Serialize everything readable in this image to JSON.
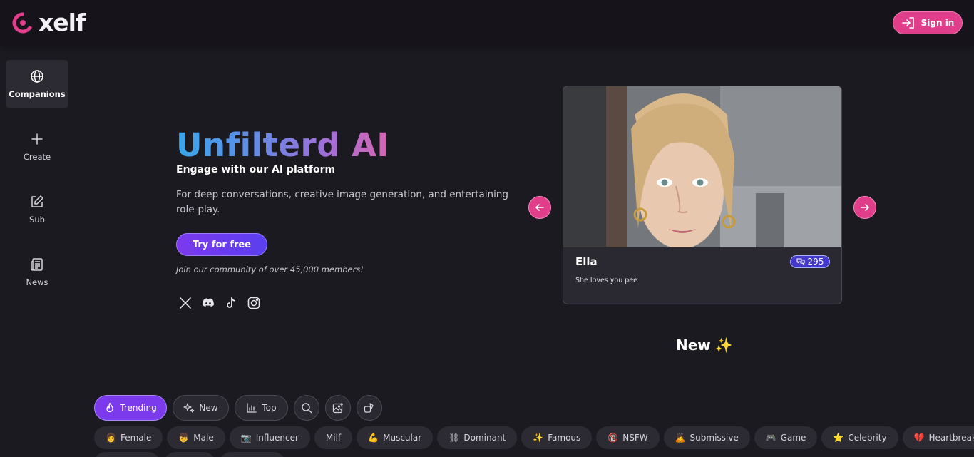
{
  "header": {
    "logo_text": "xelf",
    "signin_label": "Sign in",
    "accent_color": "#e03e8a"
  },
  "sidebar": {
    "items": [
      {
        "label": "Companions",
        "icon": "globe-icon",
        "active": true
      },
      {
        "label": "Create",
        "icon": "plus-icon",
        "active": false
      },
      {
        "label": "Sub",
        "icon": "edit-icon",
        "active": false
      },
      {
        "label": "News",
        "icon": "newspaper-icon",
        "active": false
      }
    ]
  },
  "hero": {
    "title": "Unfilterd AI",
    "subtitle": "Engage with our AI platform",
    "description": "For deep conversations, creative image generation, and entertaining role-play.",
    "cta_label": "Try for free",
    "community_note": "Join our community of over 45,000 members!",
    "socials": [
      "x-icon",
      "discord-icon",
      "tiktok-icon",
      "instagram-icon"
    ]
  },
  "featured_card": {
    "name": "Ella",
    "chat_count": "295",
    "description": "She loves you pee"
  },
  "new_section": {
    "heading": "New",
    "emoji": "✨"
  },
  "filters": {
    "tabs": [
      {
        "label": "Trending",
        "icon": "flame-icon",
        "active": true
      },
      {
        "label": "New",
        "icon": "sparkles-icon",
        "active": false
      },
      {
        "label": "Top",
        "icon": "bar-chart-icon",
        "active": false
      }
    ],
    "tool_icons": [
      "search-icon",
      "image-add-icon",
      "shapes-icon"
    ]
  },
  "tags": [
    {
      "emoji": "👩",
      "label": "Female"
    },
    {
      "emoji": "👦",
      "label": "Male"
    },
    {
      "emoji": "📷",
      "label": "Influencer"
    },
    {
      "emoji": "",
      "label": "Milf"
    },
    {
      "emoji": "💪",
      "label": "Muscular"
    },
    {
      "emoji": "⛓",
      "label": "Dominant"
    },
    {
      "emoji": "✨",
      "label": "Famous"
    },
    {
      "emoji": "🔞",
      "label": "NSFW"
    },
    {
      "emoji": "🙇",
      "label": "Submissive"
    },
    {
      "emoji": "🎮",
      "label": "Game"
    },
    {
      "emoji": "⭐",
      "label": "Celebrity"
    },
    {
      "emoji": "💔",
      "label": "Heartbreak"
    }
  ]
}
